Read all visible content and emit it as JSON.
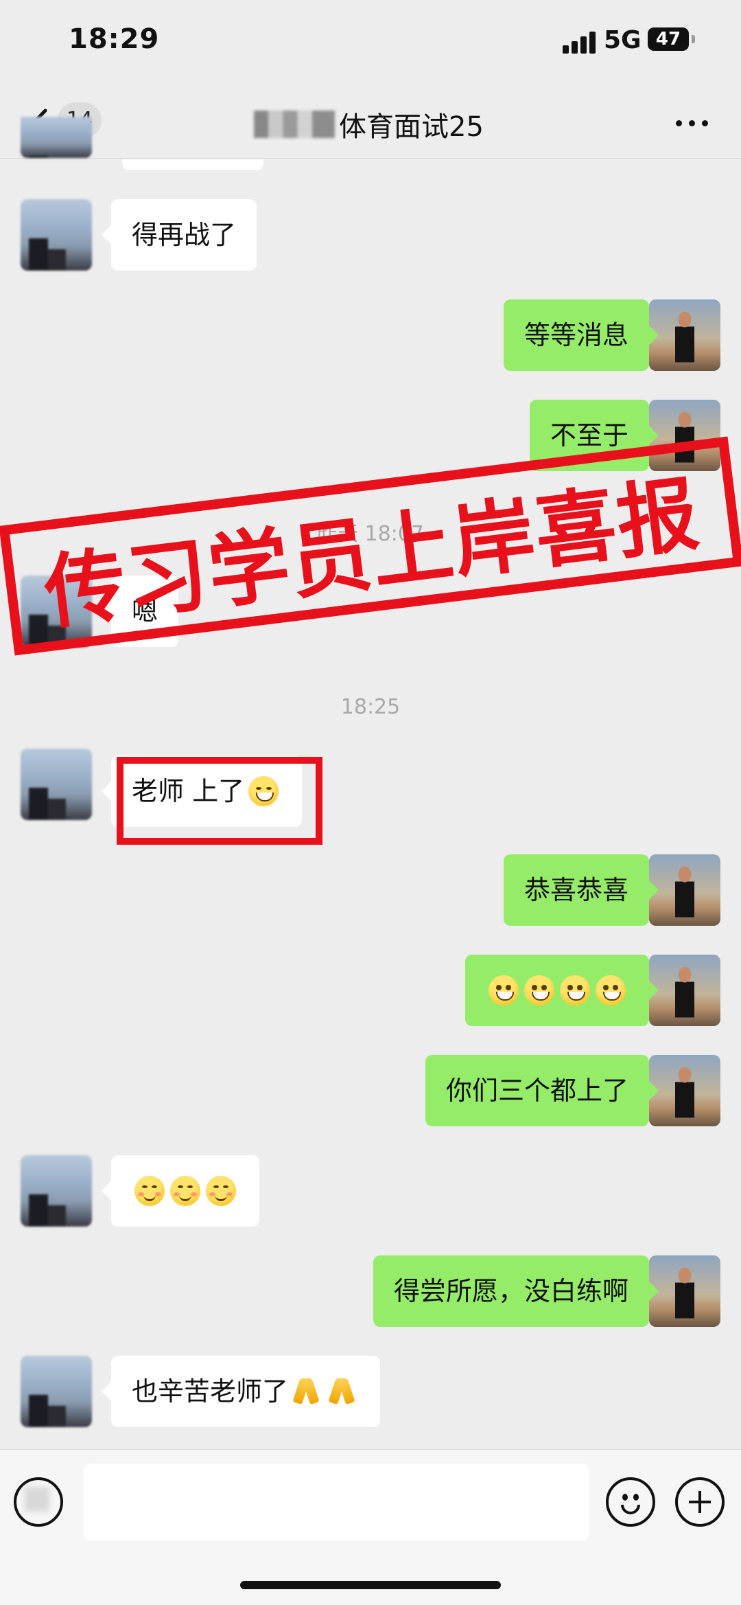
{
  "status_bar": {
    "time": "18:29",
    "network": "5G",
    "battery": "47"
  },
  "nav": {
    "unread_count": "14",
    "title": "体育面试25"
  },
  "stamp": {
    "text": "传习学员上岸喜报"
  },
  "messages": [
    {
      "side": "in",
      "text": "得再战了"
    },
    {
      "side": "out",
      "text": "等等消息"
    },
    {
      "side": "out",
      "text": "不至于"
    },
    {
      "side": "divider",
      "text": "昨天 18:07"
    },
    {
      "side": "in",
      "text": "嗯"
    },
    {
      "side": "divider",
      "text": "18:25"
    },
    {
      "side": "in",
      "text": "老师 上了"
    },
    {
      "side": "out",
      "text": "恭喜恭喜"
    },
    {
      "side": "out",
      "emoji": [
        "grin",
        "grin",
        "grin",
        "grin"
      ]
    },
    {
      "side": "out",
      "text": "你们三个都上了"
    },
    {
      "side": "in",
      "emoji": [
        "blush",
        "blush",
        "blush"
      ]
    },
    {
      "side": "out",
      "text": "得尝所愿，没白练啊"
    },
    {
      "side": "in",
      "text": "也辛苦老师了"
    }
  ],
  "icons": {
    "back": "chevron-left-icon",
    "more": "more-dots-icon",
    "voice": "voice-icon",
    "emoji": "emoji-smile-icon",
    "plus": "plus-circle-icon"
  },
  "colors": {
    "outgoing_bubble": "#95ec69",
    "incoming_bubble": "#ffffff",
    "stamp_red": "#e8101a",
    "background": "#ededed"
  }
}
